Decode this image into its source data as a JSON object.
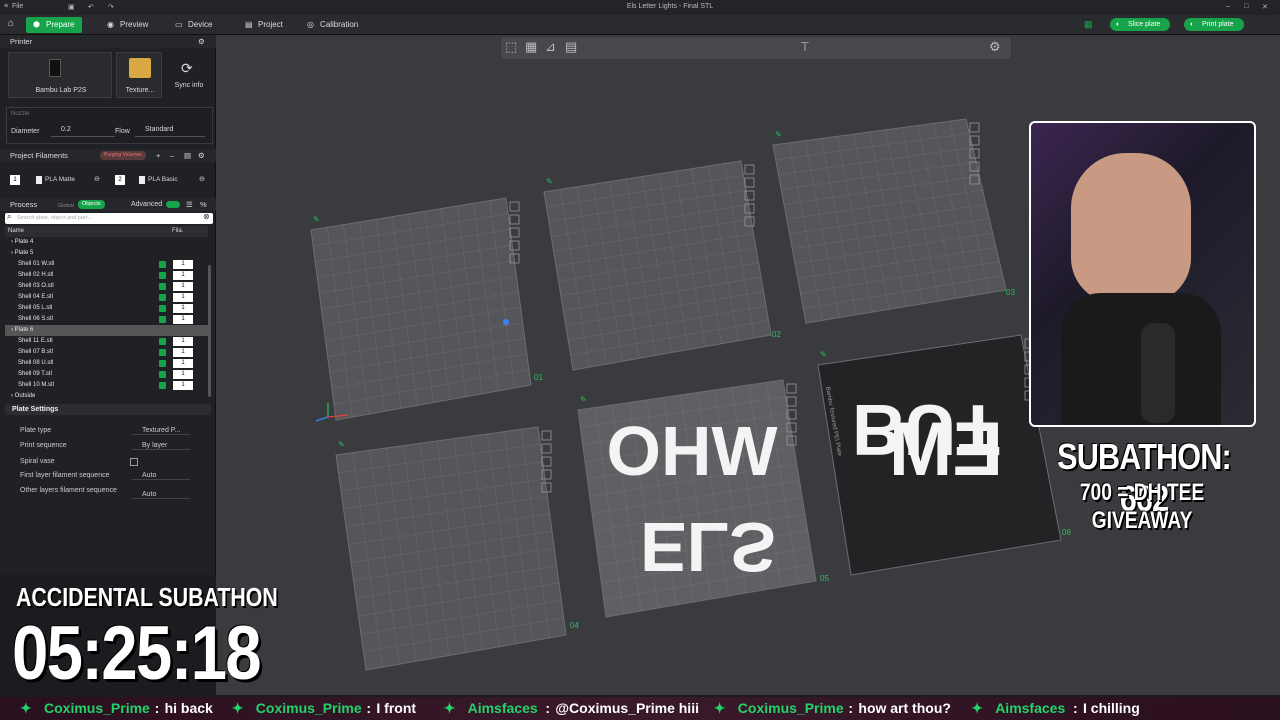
{
  "window": {
    "menu_file": "File",
    "title": "Els Letter Lights - Final STL"
  },
  "toolbar": {
    "tabs": [
      {
        "label": "Prepare",
        "active": true
      },
      {
        "label": "Preview"
      },
      {
        "label": "Device"
      },
      {
        "label": "Project"
      },
      {
        "label": "Calibration"
      }
    ],
    "slice_label": "Slice plate",
    "print_label": "Print plate"
  },
  "sidebar": {
    "printer_header": "Printer",
    "printer_name": "Bambu Lab P2S",
    "plate_texture": "Texture...",
    "sync_label": "Sync info",
    "nozzle_label": "Nozzle",
    "diameter_label": "Diameter",
    "diameter_value": "0.2",
    "flow_label": "Flow",
    "flow_value": "Standard",
    "filaments_header": "Project Filaments",
    "filament_badge": "Purging Volumes",
    "filaments": [
      {
        "slot": "1",
        "name": "PLA Matte"
      },
      {
        "slot": "2",
        "name": "PLA Basic"
      }
    ],
    "process_header": "Process",
    "process_global": "Global",
    "process_objects": "Objects",
    "advanced_label": "Advanced",
    "search_placeholder": "Search plate, object and part...",
    "col_name": "Name",
    "col_fila": "Fila.",
    "tree": [
      {
        "label": "Plate 4",
        "level": 0
      },
      {
        "label": "Plate 5",
        "level": 0
      },
      {
        "label": "Shell 01 W.stl",
        "level": 1,
        "fila": "1"
      },
      {
        "label": "Shell 02 H.stl",
        "level": 1,
        "fila": "1"
      },
      {
        "label": "Shell 03 O.stl",
        "level": 1,
        "fila": "1"
      },
      {
        "label": "Shell 04 E.stl",
        "level": 1,
        "fila": "1"
      },
      {
        "label": "Shell 05 L.stl",
        "level": 1,
        "fila": "1"
      },
      {
        "label": "Shell 06 S.stl",
        "level": 1,
        "fila": "1"
      },
      {
        "label": "Plate 6",
        "level": 0,
        "selected": true
      },
      {
        "label": "Shell 11 E.stl",
        "level": 1,
        "fila": "1"
      },
      {
        "label": "Shell 07 B.stl",
        "level": 1,
        "fila": "1"
      },
      {
        "label": "Shell 08 U.stl",
        "level": 1,
        "fila": "1"
      },
      {
        "label": "Shell 09 T.stl",
        "level": 1,
        "fila": "1"
      },
      {
        "label": "Shell 10 M.stl",
        "level": 1,
        "fila": "1"
      },
      {
        "label": "Outside",
        "level": 0
      }
    ],
    "plate_settings_header": "Plate Settings",
    "plate_settings": [
      {
        "label": "Plate type",
        "value": "Textured P..."
      },
      {
        "label": "Print sequence",
        "value": "By layer"
      },
      {
        "label": "Spiral vase",
        "value": ""
      },
      {
        "label": "First layer filament sequence",
        "value": "Auto"
      },
      {
        "label": "Other layers filament sequence",
        "value": "Auto"
      }
    ]
  },
  "viewport": {
    "plates": [
      {
        "number": "01"
      },
      {
        "number": "02"
      },
      {
        "number": "03"
      },
      {
        "number": "04"
      },
      {
        "number": "05"
      },
      {
        "number": "06"
      }
    ],
    "plate5_text_top": "WHO",
    "plate5_text_bottom": "ELS",
    "plate6_text_top": "BUT",
    "plate6_text_bottom": "EM",
    "plate6_brand": "Bambu Textured PEI Plate"
  },
  "overlay": {
    "subathon_count": "SUBATHON: 662",
    "subathon_goal": "700 = DH TEE GIVEAWAY",
    "accidental_label": "ACCIDENTAL SUBATHON",
    "timer": "05:25:18"
  },
  "chat": [
    {
      "user": "Coximus_Prime",
      "msg": "hi back"
    },
    {
      "user": "Coximus_Prime",
      "msg": "I front"
    },
    {
      "user": "Aimsfaces",
      "msg": "@Coximus_Prime hiii"
    },
    {
      "user": "Coximus_Prime",
      "msg": "how art thou?"
    },
    {
      "user": "Aimsfaces",
      "msg": "I chilling"
    }
  ],
  "colors": {
    "accent": "#16a34a",
    "plate_grid": "#8a8b8f",
    "plate_label": "#22c55e"
  }
}
